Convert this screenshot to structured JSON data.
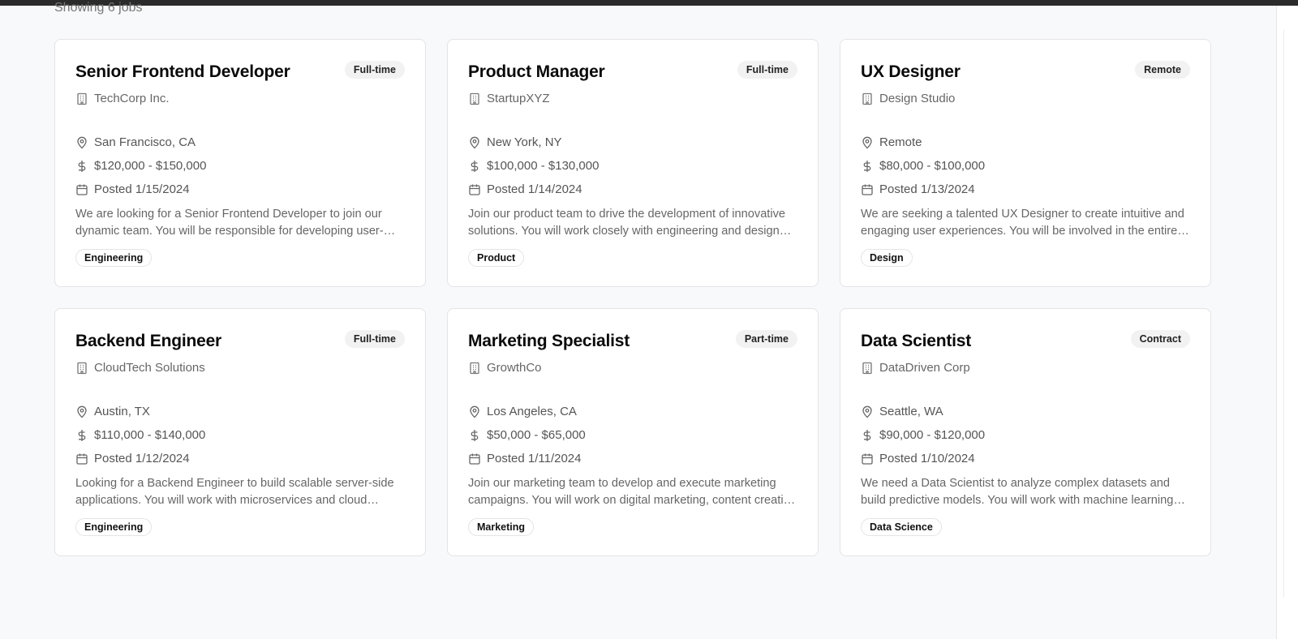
{
  "results": {
    "showing": "Showing 6 jobs"
  },
  "icons": {
    "company": "building-icon",
    "location": "map-pin-icon",
    "salary": "dollar-icon",
    "posted": "calendar-icon"
  },
  "jobs": [
    {
      "title": "Senior Frontend Developer",
      "type": "Full-time",
      "company": "TechCorp Inc.",
      "location": "San Francisco, CA",
      "salary": "$120,000 - $150,000",
      "posted": "Posted 1/15/2024",
      "description": "We are looking for a Senior Frontend Developer to join our dynamic team. You will be responsible for developing user-facing features.",
      "category": "Engineering"
    },
    {
      "title": "Product Manager",
      "type": "Full-time",
      "company": "StartupXYZ",
      "location": "New York, NY",
      "salary": "$100,000 - $130,000",
      "posted": "Posted 1/14/2024",
      "description": "Join our product team to drive the development of innovative solutions. You will work closely with engineering and design teams.",
      "category": "Product"
    },
    {
      "title": "UX Designer",
      "type": "Remote",
      "company": "Design Studio",
      "location": "Remote",
      "salary": "$80,000 - $100,000",
      "posted": "Posted 1/13/2024",
      "description": "We are seeking a talented UX Designer to create intuitive and engaging user experiences. You will be involved in the entire design process.",
      "category": "Design"
    },
    {
      "title": "Backend Engineer",
      "type": "Full-time",
      "company": "CloudTech Solutions",
      "location": "Austin, TX",
      "salary": "$110,000 - $140,000",
      "posted": "Posted 1/12/2024",
      "description": "Looking for a Backend Engineer to build scalable server-side applications. You will work with microservices and cloud infrastructure.",
      "category": "Engineering"
    },
    {
      "title": "Marketing Specialist",
      "type": "Part-time",
      "company": "GrowthCo",
      "location": "Los Angeles, CA",
      "salary": "$50,000 - $65,000",
      "posted": "Posted 1/11/2024",
      "description": "Join our marketing team to develop and execute marketing campaigns. You will work on digital marketing, content creation and analytics.",
      "category": "Marketing"
    },
    {
      "title": "Data Scientist",
      "type": "Contract",
      "company": "DataDriven Corp",
      "location": "Seattle, WA",
      "salary": "$90,000 - $120,000",
      "posted": "Posted 1/10/2024",
      "description": "We need a Data Scientist to analyze complex datasets and build predictive models. You will work with machine learning algorithms.",
      "category": "Data Science"
    }
  ]
}
